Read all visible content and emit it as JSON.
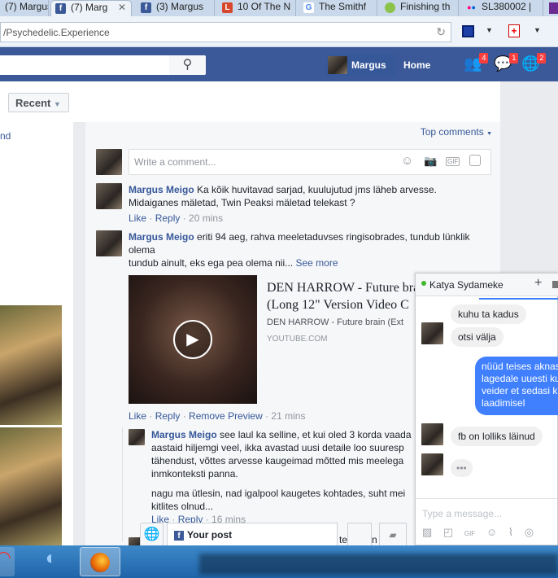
{
  "browser": {
    "tabs": [
      {
        "label": "(7) Margus",
        "icon": "facebook-icon"
      },
      {
        "label": "(7) Marg",
        "icon": "facebook-icon",
        "active": true
      },
      {
        "label": "(3) Margus",
        "icon": "facebook-icon"
      },
      {
        "label": "10 Of The N",
        "icon": "listverse-icon",
        "glyph": "L"
      },
      {
        "label": "The Smithf",
        "icon": "google-icon",
        "glyph": "G"
      },
      {
        "label": "Finishing th",
        "icon": "chat-bubble-icon"
      },
      {
        "label": "SL380002 |",
        "icon": "flickr-icon"
      }
    ],
    "url": "/Psychedelic.Experience"
  },
  "fb": {
    "profile_name": "Margus",
    "home": "Home",
    "badges": {
      "friends": "4",
      "messages": "1",
      "notifications": "2"
    },
    "recent": "Recent",
    "left_link": "nd",
    "top_comments": "Top comments",
    "write_placeholder": "Write a comment...",
    "comments": [
      {
        "author": "Margus Meigo",
        "text1": "Ka kõik huvitavad sarjad, kuulujutud jms läheb arvesse.",
        "text2": "Midaiganes mäletad, Twin Peaksi mäletad telekast ?",
        "like": "Like",
        "reply": "Reply",
        "time": "20 mins"
      },
      {
        "author": "Margus Meigo",
        "text1": "eriti 94 aeg, rahva meeletaduvses ringisobrades, tundub lünklik",
        "text2": "olema",
        "text3": "tundub ainult, eks ega pea olema nii...",
        "see_more": "See more",
        "like": "Like",
        "reply": "Reply",
        "remove_preview": "Remove Preview",
        "time": "21 mins",
        "preview": {
          "title1": "DEN HARROW - Future brain",
          "title2": "(Long 12\" Version Video C",
          "desc": "DEN HARROW - Future brain (Ext",
          "domain": "YOUTUBE.COM"
        }
      },
      {
        "author": "Margus Meigo",
        "lines": [
          "see laul ka selline, et kui oled 3 korda vaada",
          "aastaid hiljemgi veel, ikka avastad uusi detaile loo suuresp",
          "tähendust, võttes arvesse kaugeimad mõtted mis meelega",
          "inmkonteksti panna."
        ],
        "lines2": [
          "nagu ma ütlesin, nad igalpool kaugetes kohtades, suht mei",
          "kitlites olnud..."
        ],
        "like": "Like",
        "reply": "Reply",
        "time": "16 mins"
      }
    ],
    "your_post": "Your post",
    "partial_text": "te      me      on"
  },
  "chat": {
    "name": "Katya Sydameke",
    "messages_in1": [
      "kuhu ta kadus",
      "otsi välja"
    ],
    "message_out": [
      "nüüd teises aknas",
      "lagedale uuesti ku",
      "veider et sedasi ka",
      "laadimisel"
    ],
    "message_in2": "fb on lolliks läinud",
    "typing": "•••",
    "placeholder": "Type a message..."
  },
  "colors": {
    "fb_blue": "#3b5998",
    "link": "#365899",
    "chat_blue": "#4080ff",
    "badge": "#fa3e3e"
  }
}
